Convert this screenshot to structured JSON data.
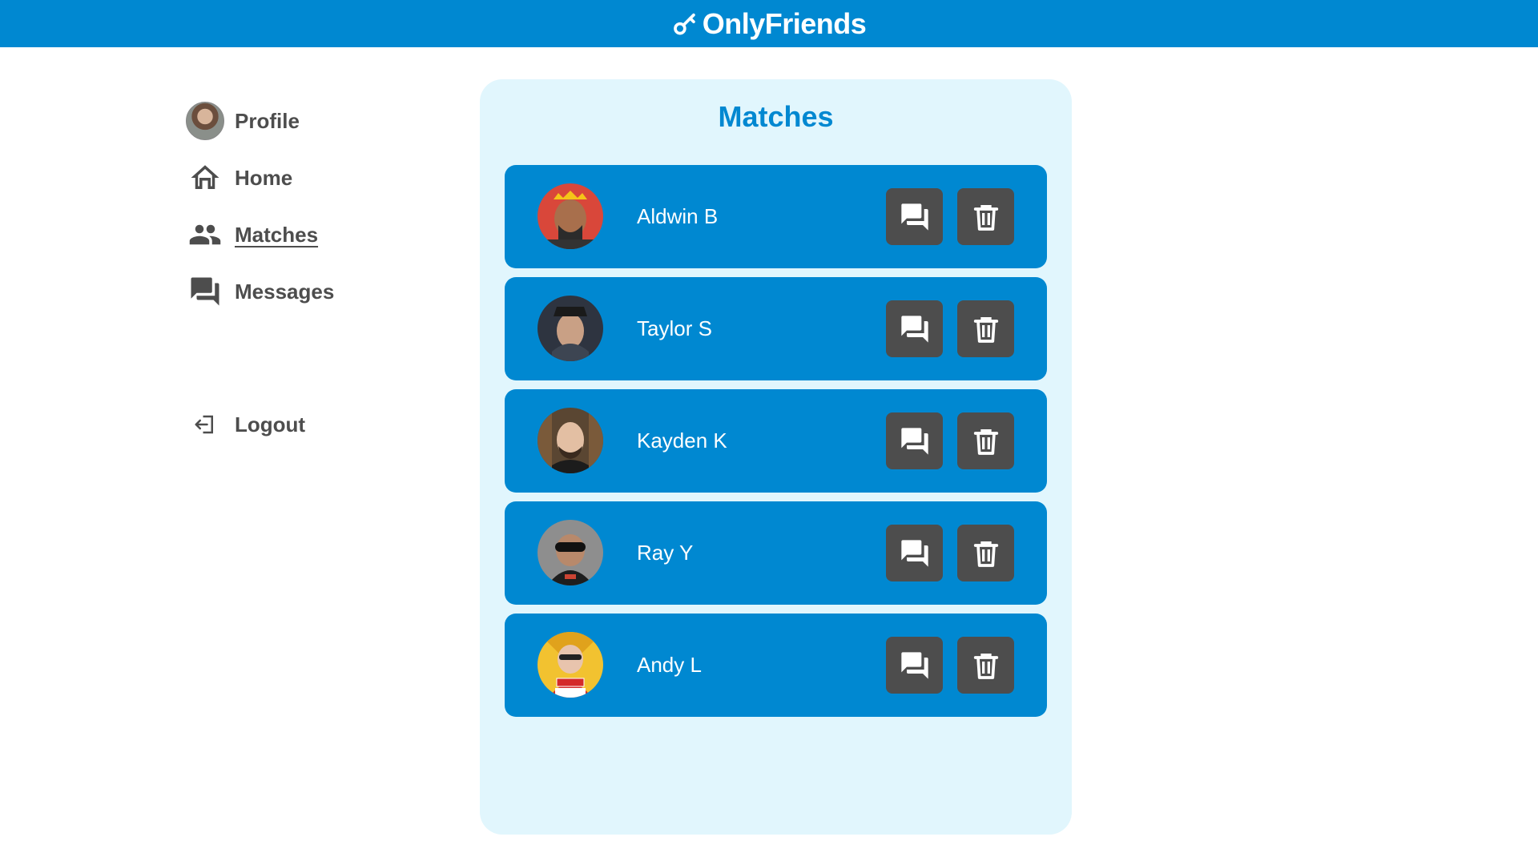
{
  "app": {
    "brand": "OnlyFriends"
  },
  "sidebar": {
    "items": [
      {
        "label": "Profile",
        "icon": "avatar"
      },
      {
        "label": "Home",
        "icon": "home-icon"
      },
      {
        "label": "Matches",
        "icon": "people-icon",
        "active": true
      },
      {
        "label": "Messages",
        "icon": "chat-icon"
      },
      {
        "label": "Logout",
        "icon": "logout-icon"
      }
    ]
  },
  "main": {
    "title": "Matches",
    "matches": [
      {
        "name": "Aldwin B"
      },
      {
        "name": "Taylor S"
      },
      {
        "name": "Kayden K"
      },
      {
        "name": "Ray Y"
      },
      {
        "name": "Andy L"
      }
    ]
  },
  "colors": {
    "primary": "#0088d1",
    "panel_bg": "#e1f6fd",
    "button_bg": "#4d4d4d",
    "text_dark": "#4d4d4d"
  }
}
